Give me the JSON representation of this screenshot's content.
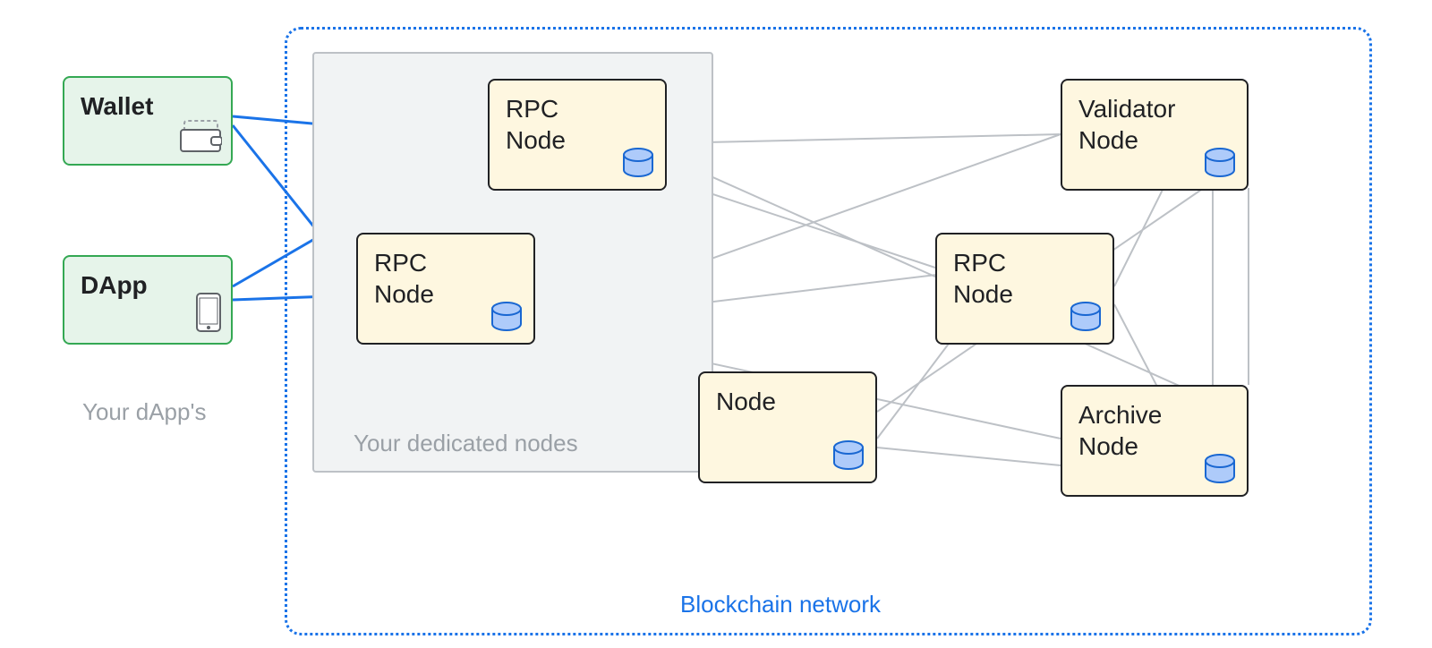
{
  "clients": {
    "wallet": {
      "label": "Wallet"
    },
    "dapp": {
      "label": "DApp"
    },
    "caption": "Your dApp's"
  },
  "dedicated": {
    "caption": "Your dedicated nodes",
    "rpc1": {
      "label": "RPC\nNode"
    },
    "rpc2": {
      "label": "RPC\nNode"
    }
  },
  "network": {
    "caption": "Blockchain network",
    "node": {
      "label": "Node"
    },
    "rpc": {
      "label": "RPC\nNode"
    },
    "validator": {
      "label": "Validator\nNode"
    },
    "archive": {
      "label": "Archive\nNode"
    }
  },
  "colors": {
    "client_fill": "#e6f4ea",
    "client_border": "#34a853",
    "node_fill": "#fef7e0",
    "node_border": "#202124",
    "accent_blue": "#1a73e8",
    "mesh_gray": "#bdc1c6"
  }
}
